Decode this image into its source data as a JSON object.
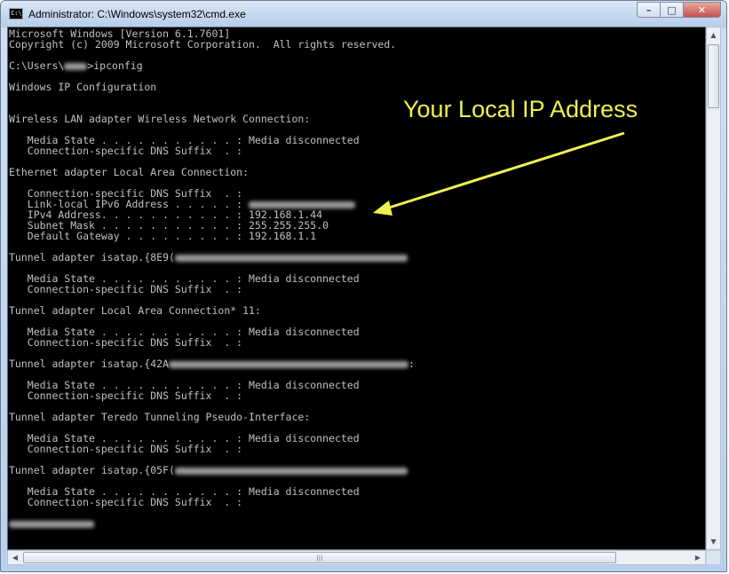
{
  "window": {
    "title": "Administrator: C:\\Windows\\system32\\cmd.exe",
    "icon_text": "C:\\"
  },
  "caption_buttons": {
    "minimize": "–",
    "maximize": "□",
    "close": "✕"
  },
  "console": {
    "lines": [
      "Microsoft Windows [Version 6.1.7601]",
      "Copyright (c) 2009 Microsoft Corporation.  All rights reserved.",
      "",
      "C:\\Users\\",
      "",
      "Windows IP Configuration",
      "",
      "",
      "Wireless LAN adapter Wireless Network Connection:",
      "",
      "   Media State . . . . . . . . . . . : Media disconnected",
      "   Connection-specific DNS Suffix  . :",
      "",
      "Ethernet adapter Local Area Connection:",
      "",
      "   Connection-specific DNS Suffix  . :",
      "   Link-local IPv6 Address . . . . . :",
      "   IPv4 Address. . . . . . . . . . . : 192.168.1.44",
      "   Subnet Mask . . . . . . . . . . . : 255.255.255.0",
      "   Default Gateway . . . . . . . . . : 192.168.1.1",
      "",
      "Tunnel adapter isatap.{8E9(",
      "",
      "   Media State . . . . . . . . . . . : Media disconnected",
      "   Connection-specific DNS Suffix  . :",
      "",
      "Tunnel adapter Local Area Connection* 11:",
      "",
      "   Media State . . . . . . . . . . . : Media disconnected",
      "   Connection-specific DNS Suffix  . :",
      "",
      "Tunnel adapter isatap.{42A",
      "",
      "   Media State . . . . . . . . . . . : Media disconnected",
      "   Connection-specific DNS Suffix  . :",
      "",
      "Tunnel adapter Teredo Tunneling Pseudo-Interface:",
      "",
      "   Media State . . . . . . . . . . . : Media disconnected",
      "   Connection-specific DNS Suffix  . :",
      "",
      "Tunnel adapter isatap.{05F(",
      "",
      "   Media State . . . . . . . . . . . : Media disconnected",
      "   Connection-specific DNS Suffix  . :",
      "",
      ""
    ],
    "prompt_command": "ipconfig"
  },
  "annotation": {
    "label": "Your Local IP Address",
    "color": "#f0f050"
  },
  "scrollbars": {
    "up_arrow": "▲",
    "down_arrow": "▼",
    "left_arrow": "◀",
    "right_arrow": "▶",
    "grip": "|||"
  }
}
